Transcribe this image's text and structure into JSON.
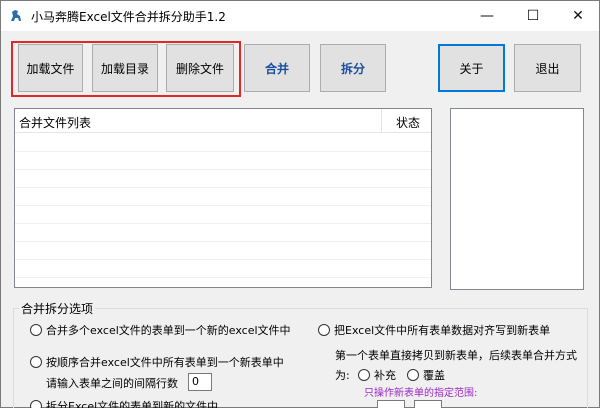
{
  "window": {
    "title": "小马奔腾Excel文件合并拆分助手1.2",
    "controls": {
      "minimize": "—",
      "maximize": "☐",
      "close": "✕"
    }
  },
  "toolbar": {
    "load_file": "加载文件",
    "load_dir": "加载目录",
    "delete_file": "删除文件",
    "merge": "合并",
    "split": "拆分",
    "about": "关于",
    "exit": "退出"
  },
  "file_list": {
    "col_name": "合并文件列表",
    "col_status": "状态"
  },
  "options": {
    "group_title": "合并拆分选项",
    "opt1": "合并多个excel文件的表单到一个新的excel文件中",
    "opt2": "把Excel文件中所有表单数据对齐写到新表单",
    "opt3": "按顺序合并excel文件中所有表单到一个新表单中",
    "interval_label": "请输入表单之间的间隔行数",
    "interval_value": "0",
    "first_sheet_text": "第一个表单直接拷贝到新表单，后续表单合并方式",
    "as_label": "为:",
    "supplement": "补充",
    "overwrite": "覆盖",
    "range_hint": "只操作新表单的指定范围:",
    "opt4": "拆分Excel文件的表单到新的文件中"
  },
  "colors": {
    "highlight": "#e0282a",
    "accent_text": "#1a4e9e",
    "hint_text": "#9b27c4"
  }
}
